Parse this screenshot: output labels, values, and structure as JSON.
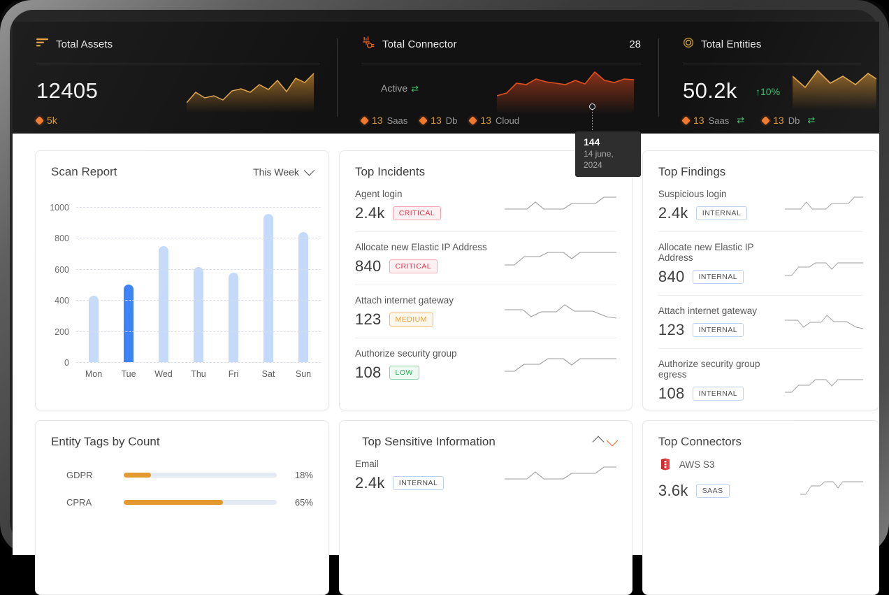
{
  "kpis": {
    "assets": {
      "icon": "bars-descending-icon",
      "title": "Total Assets",
      "value": "12405",
      "legend": [
        {
          "num": "5k",
          "label": ""
        }
      ]
    },
    "connector": {
      "icon": "plug-connector-icon",
      "title": "Total Connector",
      "count": "28",
      "status": "Active",
      "legend": [
        {
          "num": "13",
          "label": "Saas"
        },
        {
          "num": "13",
          "label": "Db"
        },
        {
          "num": "13",
          "label": "Cloud"
        }
      ],
      "tooltip": {
        "value": "144",
        "date": "14 june, 2024"
      }
    },
    "entities": {
      "icon": "ring-icon",
      "title": "Total Entities",
      "value": "50.2k",
      "delta": "↑10%",
      "legend": [
        {
          "num": "13",
          "label": "Saas"
        },
        {
          "num": "13",
          "label": "Db"
        }
      ]
    }
  },
  "scan_report": {
    "title": "Scan Report",
    "range_label": "This Week"
  },
  "chart_data": {
    "type": "bar",
    "title": "Scan Report",
    "xlabel": "",
    "ylabel": "",
    "categories": [
      "Mon",
      "Tue",
      "Wed",
      "Thu",
      "Fri",
      "Sat",
      "Sun"
    ],
    "values": [
      430,
      500,
      750,
      612,
      575,
      955,
      838
    ],
    "highlight_index": 1,
    "yticks": [
      0,
      200,
      400,
      600,
      800,
      1000
    ],
    "ylim": [
      0,
      1000
    ],
    "grid": true,
    "legend": "none",
    "bar_color": "#c5dafa",
    "highlight_color": "#3b82f6"
  },
  "top_incidents": {
    "title": "Top Incidents",
    "rows": [
      {
        "name": "Agent login",
        "value": "2.4k",
        "badge": "CRITICAL",
        "badge_class": "b-critical"
      },
      {
        "name": "Allocate new Elastic IP Address",
        "value": "840",
        "badge": "CRITICAL",
        "badge_class": "b-critical"
      },
      {
        "name": "Attach internet gateway",
        "value": "123",
        "badge": "MEDIUM",
        "badge_class": "b-medium"
      },
      {
        "name": "Authorize security group",
        "value": "108",
        "badge": "LOW",
        "badge_class": "b-low"
      }
    ]
  },
  "top_findings": {
    "title": "Top Findings",
    "rows": [
      {
        "name": "Suspicious login",
        "value": "2.4k",
        "badge": "INTERNAL",
        "badge_class": "b-internal"
      },
      {
        "name": "Allocate new Elastic IP Address",
        "value": "840",
        "badge": "INTERNAL",
        "badge_class": "b-internal"
      },
      {
        "name": "Attach internet gateway",
        "value": "123",
        "badge": "INTERNAL",
        "badge_class": "b-internal"
      },
      {
        "name": "Authorize security group egress",
        "value": "108",
        "badge": "INTERNAL",
        "badge_class": "b-internal"
      }
    ]
  },
  "entity_tags": {
    "title": "Entity Tags by Count",
    "rows": [
      {
        "name": "GDPR",
        "pct": "18%",
        "value": 18
      },
      {
        "name": "CPRA",
        "pct": "65%",
        "value": 65
      }
    ]
  },
  "sensitive_info": {
    "title": "Top Sensitive Information",
    "rows": [
      {
        "name": "Email",
        "value": "2.4k",
        "badge": "INTERNAL",
        "badge_class": "b-internal"
      }
    ]
  },
  "top_connectors": {
    "title": "Top Connectors",
    "rows": [
      {
        "icon": "aws-s3-icon",
        "name": "AWS S3",
        "value": "3.6k",
        "badge": "SAAS",
        "badge_class": "b-internal"
      }
    ]
  },
  "colors": {
    "accent": "#f26522",
    "gold": "#d89a3c",
    "green": "#38c172",
    "blue": "#3b82f6",
    "blue_light": "#c5dafa",
    "orange_bar": "#e3992e"
  }
}
